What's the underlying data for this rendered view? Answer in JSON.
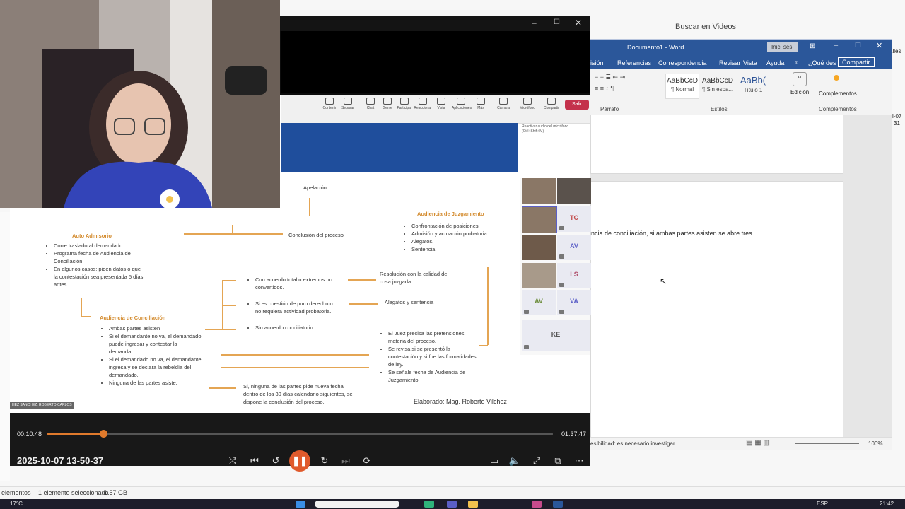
{
  "explorer": {
    "search_placeholder": "Buscar en Videos",
    "statusbar": {
      "items": "elementos",
      "selected": "1 elemento seleccionado",
      "size": "1.57 GB"
    }
  },
  "taskbar": {
    "weather": "17°C",
    "lang": "ESP",
    "time": "21:42"
  },
  "word": {
    "title": "Documento1 - Word",
    "signin": "Inic. ses.",
    "tabs": [
      "isión",
      "Referencias",
      "Correspondencia",
      "Revisar",
      "Vista",
      "Ayuda"
    ],
    "tell_me": "¿Qué des",
    "share": "Compartir",
    "styles": [
      {
        "sample": "AaBbCcD",
        "name": "¶ Normal"
      },
      {
        "sample": "AaBbCcD",
        "name": "¶ Sin espa..."
      },
      {
        "sample": "AaBb(",
        "name": "Título 1"
      }
    ],
    "groups": {
      "paragraph": "Párrafo",
      "styles": "Estilos",
      "addins": "Complementos"
    },
    "edit_label": "Edición",
    "addins_label": "Complementos",
    "body_text": "ncia de conciliación, si ambas partes asisten se abre tres",
    "status_text": "esibilidad: es necesario investigar",
    "zoom": "100%"
  },
  "side_labels": {
    "a": "alles",
    "b": "l-07",
    "c": "31"
  },
  "teams": {
    "toolbar": [
      "Contenir",
      "Separar",
      "Chat",
      "Gente",
      "Participar",
      "Reaccionar",
      "Vista",
      "Aplicaciones",
      "Más",
      "Cámara",
      "Micrófono",
      "Compartir"
    ],
    "leave": "Salir",
    "tooltip": "Reactivar audio del micrófono (Ctrl+Shift+M)",
    "participants": [
      "TC",
      "AV",
      "LS",
      "AV",
      "VA",
      "KE"
    ],
    "presenter_tag": "HEZ SANCHEZ, ROBERTO CARLOS"
  },
  "slide": {
    "apelacion": "Apelación",
    "conclusion": "Conclusión del proceso",
    "auto_admisorio": "Auto Admisorio",
    "auto_items": [
      "Corre traslado al demandado.",
      "Programa fecha de Audiencia de Conciliación.",
      "En algunos casos: piden datos o que la contestación sea presentada 5 días antes."
    ],
    "audiencia_conc": "Audiencia de Conciliación",
    "conc_items": [
      "Ambas partes asisten",
      "Si el demandante no va, el demandado puede ingresar y contestar la demanda.",
      "Si el demandado no va, el demandante ingresa y se declara la rebeldía del demandado.",
      "Ninguna de las partes asiste."
    ],
    "audiencia_juzg": "Audiencia de Juzgamiento",
    "juzg_items": [
      "Confrontación de posiciones.",
      "Admisión y actuación probatoria.",
      "Alegatos.",
      "Sentencia."
    ],
    "acuerdo_total": "Con acuerdo total o extremos no convertidos.",
    "puro_derecho": "Si es cuestión de puro derecho o no requiera actividad probatoria.",
    "sin_acuerdo": "Sin acuerdo conciliatorio.",
    "resolucion": "Resolución con la calidad de cosa juzgada",
    "alegatos": "Alegatos y sentencia",
    "juez_items": [
      "El Juez precisa las pretensiones materia del proceso.",
      "Se revisa si se presentó la contestación y si fue las formalidades de ley.",
      "Se señale fecha de Audiencia de Juzgamiento."
    ],
    "ninguna": "Si, ninguna de las partes pide nueva fecha dentro de los 30 días calendario siguientes, se dispone la conclusión del proceso.",
    "elaborado": "Elaborado: Mag. Roberto Vilchez"
  },
  "player": {
    "current_time": "00:10:48",
    "total_time": "01:37:47",
    "progress": 0.11,
    "title": "2025-10-07 13-50-37"
  },
  "colors": {
    "accent": "#e07a2c",
    "word_blue": "#2b579a",
    "teams_red": "#c4314b"
  }
}
